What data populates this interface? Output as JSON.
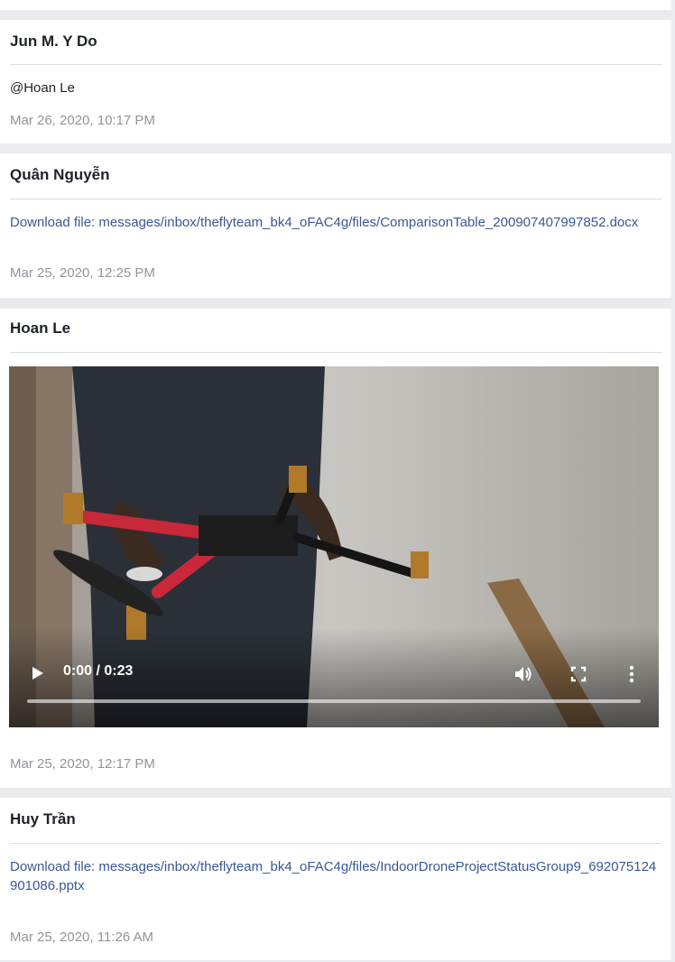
{
  "messages": [
    {
      "sender": "Jun M. Y Do",
      "text": "@Hoan Le",
      "timestamp": "Mar 26, 2020, 10:17 PM"
    },
    {
      "sender": "Quân Nguyễn",
      "link": "Download file: messages/inbox/theflyteam_bk4_oFAC4g/files/ComparisonTable_200907407997852.docx",
      "timestamp": "Mar 25, 2020, 12:25 PM"
    },
    {
      "sender": "Hoan Le",
      "video": {
        "time": "0:00 / 0:23",
        "progress": 0
      },
      "timestamp": "Mar 25, 2020, 12:17 PM"
    },
    {
      "sender": "Huy Trần",
      "link": "Download file: messages/inbox/theflyteam_bk4_oFAC4g/files/IndoorDroneProjectStatusGroup9_692075124901086.pptx",
      "timestamp": "Mar 25, 2020, 11:26 AM"
    }
  ],
  "icons": {
    "play": "play-icon",
    "volume": "volume-icon",
    "fullscreen": "fullscreen-icon",
    "more": "more-vertical-icon"
  },
  "colors": {
    "page_bg": "#e9ebee",
    "card_bg": "#ffffff",
    "link": "#385898",
    "timestamp": "#90949c",
    "sender": "#1d2129"
  }
}
